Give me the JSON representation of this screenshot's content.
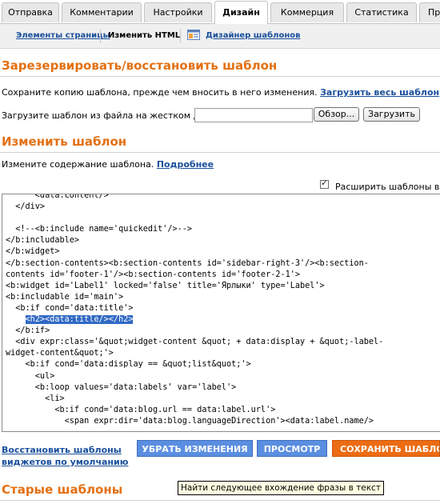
{
  "tabs": [
    {
      "label": "Отправка"
    },
    {
      "label": "Комментарии"
    },
    {
      "label": "Настройки"
    },
    {
      "label": "Дизайн"
    },
    {
      "label": "Коммерция"
    },
    {
      "label": "Статистика"
    },
    {
      "label": "Пр"
    }
  ],
  "subnav": {
    "items": [
      {
        "label": "Элементы страницы"
      },
      {
        "label": "Изменить HTML"
      },
      {
        "label": "Дизайнер шаблонов"
      }
    ]
  },
  "backup": {
    "title": "Зарезервировать/восстановить шаблон",
    "description": "Сохраните копию шаблона, прежде чем вносить в него изменения.",
    "download_link": "Загрузить весь шаблон",
    "upload_label": "Загрузите шаблон из файла на жестком диске:",
    "browse_button": "Обзор...",
    "upload_button": "Загрузить"
  },
  "edit": {
    "title": "Изменить шаблон",
    "description": "Измените содержание шаблона.",
    "more_link": "Подробнее",
    "expand_checkbox_label": "Расширить шаблоны видж",
    "code_lines": [
      "      <data:content/>",
      "  </div>",
      "",
      "  <!--<b:include name='quickedit'/>-->",
      "</b:includable>",
      "</b:widget>",
      "</b:section-contents><b:section-contents id='sidebar-right-3'/><b:section-",
      "contents id='footer-1'/><b:section-contents id='footer-2-1'>",
      "<b:widget id='Label1' locked='false' title='Ярлыки' type='Label'>",
      "<b:includable id='main'>",
      "  <b:if cond='data:title'>",
      "    <h2><data:title/></h2>",
      "  </b:if>",
      "  <div expr:class='&quot;widget-content &quot; + data:display + &quot;-label-",
      "widget-content&quot;'>",
      "    <b:if cond='data:display == &quot;list&quot;'>",
      "      <ul>",
      "      <b:loop values='data:labels' var='label'>",
      "        <li>",
      "          <b:if cond='data:blog.url == data:label.url'>",
      "            <span expr:dir='data:blog.languageDirection'><data:label.name/>"
    ]
  },
  "actions": {
    "restore_link": "Восстановить шаблоны виджетов по умолчанию",
    "restore_line1": "Восстановить шаблоны",
    "restore_line2": "виджетов по умолчанию",
    "clear_button": "УБРАТЬ ИЗМЕНЕНИЯ",
    "preview_button": "ПРОСМОТР",
    "save_button": "СОХРАНИТЬ ШАБЛОН"
  },
  "old_templates": {
    "title": "Старые шаблоны"
  },
  "tooltip": "Найти следующее вхождение фразы в текст",
  "colors": {
    "heading": "#e37012",
    "link": "#1a4f9c",
    "blue_button": "#5a8ee0",
    "orange_button": "#ec6c13",
    "selection": "#316ac5"
  }
}
